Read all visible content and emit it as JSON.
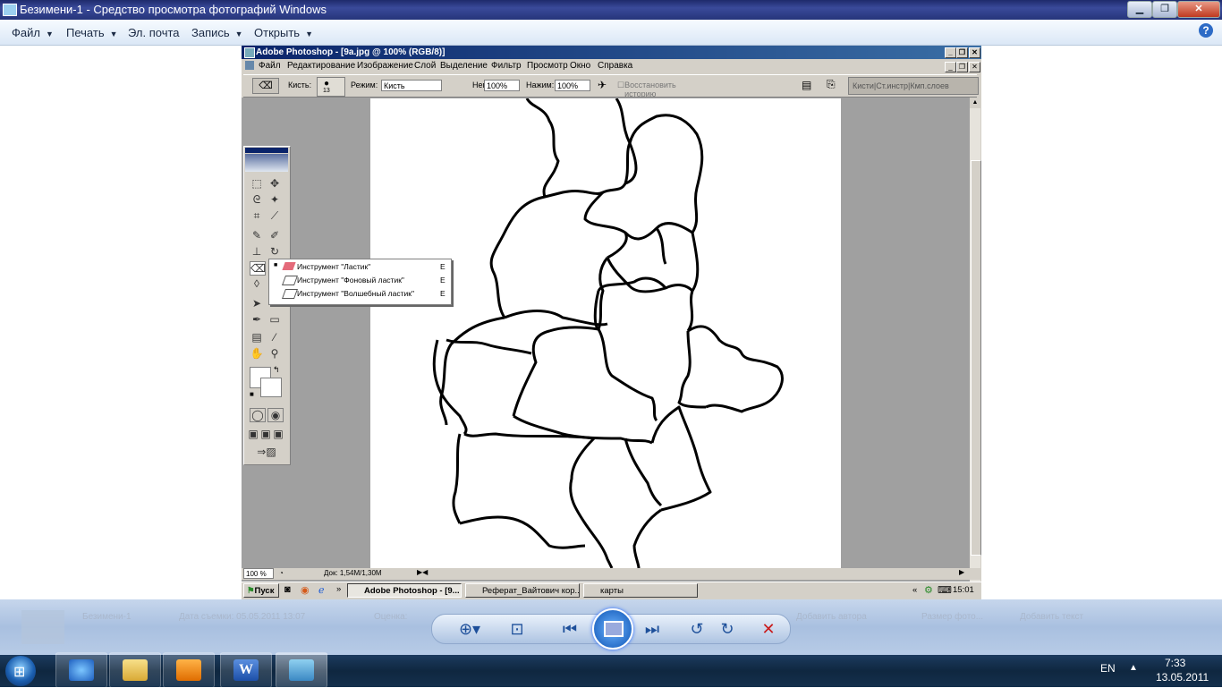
{
  "viewer": {
    "title": "Безимени-1 - Средство просмотра фотографий Windows",
    "menu": {
      "file": "Файл",
      "print": "Печать",
      "email": "Эл. почта",
      "burn": "Запись",
      "open": "Открыть"
    },
    "help_icon": "help-icon"
  },
  "photoshop": {
    "title": "Adobe Photoshop - [9a.jpg @ 100% (RGB/8)]",
    "menu": [
      "Файл",
      "Редактирование",
      "Изображение",
      "Слой",
      "Выделение",
      "Фильтр",
      "Просмотр",
      "Окно",
      "Справка"
    ],
    "options": {
      "brush_label": "Кисть:",
      "brush_size": "13",
      "mode_label": "Режим:",
      "mode_value": "Кисть",
      "opacity_label": "Непрозр.:",
      "opacity_value": "100%",
      "pressure_label": "Нажим:",
      "pressure_value": "100%",
      "history_label": "Восстановить историю",
      "palette_tabs": "Кисти|Ст.инстр|Кмп.слоев"
    },
    "flyout": [
      {
        "label": "Инструмент \"Ластик\"",
        "key": "E",
        "selected": true
      },
      {
        "label": "Инструмент \"Фоновый ластик\"",
        "key": "E",
        "selected": false
      },
      {
        "label": "Инструмент \"Волшебный ластик\"",
        "key": "E",
        "selected": false
      }
    ],
    "status": {
      "zoom": "100 %",
      "doc": "Док: 1,54M/1,30M"
    }
  },
  "xp_taskbar": {
    "start": "Пуск",
    "buttons": [
      "Adobe Photoshop - [9...",
      "Реферат_Вайтович кор...",
      "карты"
    ],
    "chevron": "«",
    "clock": "15:01"
  },
  "controls": {
    "ghost": [
      "Безимени-1",
      "Дата съемки: 05.05.2011 13:07",
      "Оценка:",
      "Добавить автора",
      "Размер фото...",
      "Добавить текст"
    ]
  },
  "win7": {
    "lang": "EN",
    "time": "7:33",
    "date": "13.05.2011"
  }
}
